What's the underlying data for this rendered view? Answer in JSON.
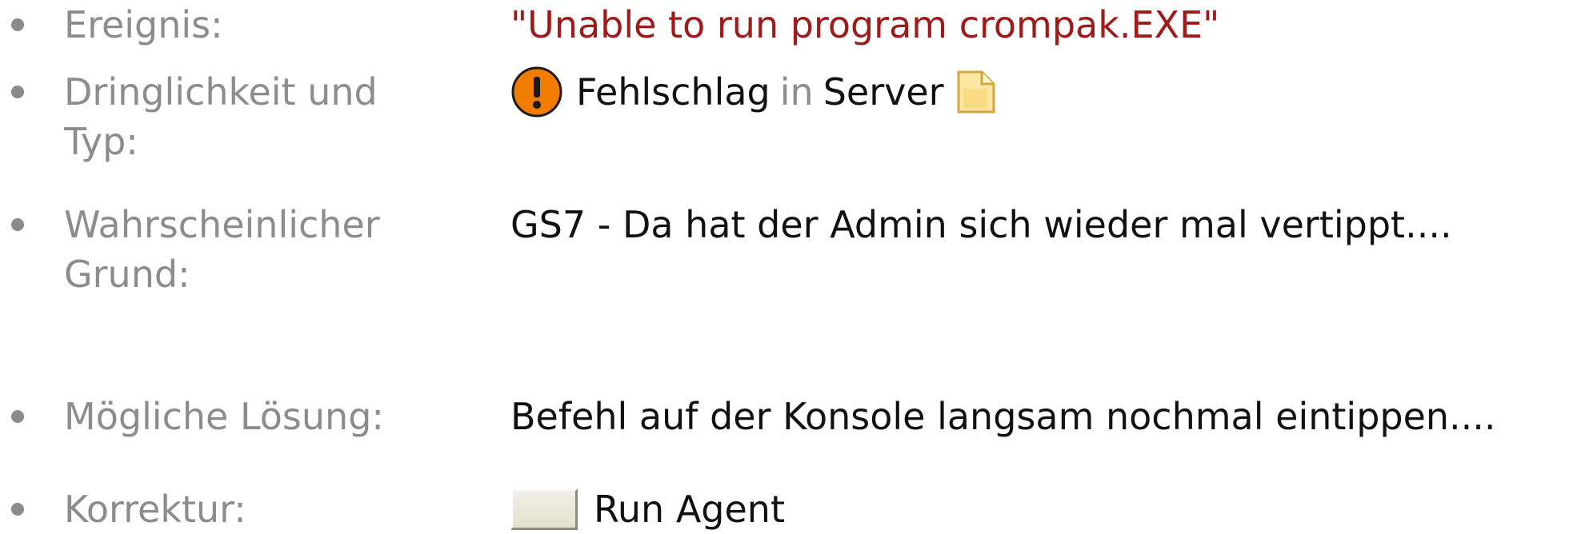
{
  "details": {
    "event": {
      "label": "Ereignis:",
      "value": "\"Unable to run program crompak.EXE\"",
      "value_color": "#a01a1a"
    },
    "severity_type": {
      "label": "Dringlichkeit und Typ:",
      "severity": "Fehlschlag",
      "joiner": "in",
      "type": "Server",
      "severity_icon": "warning-exclamation-icon",
      "severity_icon_color": "#f07d00",
      "type_icon": "document-icon"
    },
    "probable_cause": {
      "label": "Wahrscheinlicher Grund:",
      "value": "GS7 - Da hat der Admin sich wieder mal vertippt...."
    },
    "possible_solution": {
      "label": "Mögliche Lösung:",
      "value": "Befehl auf der Konsole langsam nochmal eintippen...."
    },
    "correction": {
      "label": "Korrektur:",
      "action": "Run Agent",
      "action_icon": "agent-button-icon"
    }
  }
}
